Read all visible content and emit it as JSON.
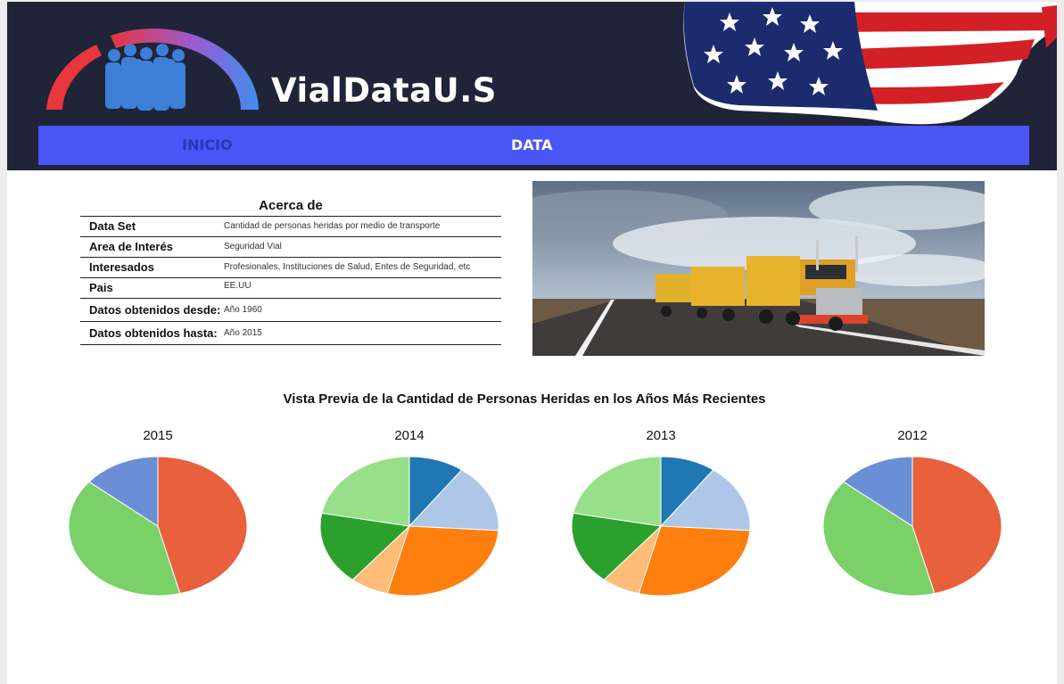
{
  "header": {
    "brand": "VialDataU.S",
    "logo_icon": "people-gauge-logo",
    "flag_icon": "usa-flag-map"
  },
  "nav": {
    "items": [
      {
        "label": "INICIO"
      },
      {
        "label": "DATA"
      }
    ]
  },
  "about": {
    "title": "Acerca de",
    "rows": [
      {
        "key": "Data Set",
        "value": "Cantidad de personas heridas por medio de transporte"
      },
      {
        "key": "Area de Interés",
        "value": "Seguridad Vial"
      },
      {
        "key": "Interesados",
        "value": "Profesionales, Instituciones de Salud, Entes de Seguridad, etc"
      },
      {
        "key": "Pais",
        "value": "EE.UU"
      },
      {
        "key": "Datos obtenidos desde:",
        "value": "Año 1960"
      },
      {
        "key": "Datos obtenidos hasta:",
        "value": "Año 2015"
      }
    ]
  },
  "photo": {
    "subject": "road-train-truck-on-highway"
  },
  "preview": {
    "title": "Vista Previa de la Cantidad de Personas Heridas en los Años Más Recientes"
  },
  "chart_data": [
    {
      "type": "pie",
      "title": "2015",
      "values": [
        46,
        40,
        14
      ],
      "colors": [
        "#e8603c",
        "#79d168",
        "#6a8fd6"
      ]
    },
    {
      "type": "pie",
      "title": "2014",
      "values": [
        10,
        16,
        28,
        7,
        17,
        22
      ],
      "colors": [
        "#1f77b4",
        "#aec7e8",
        "#ff7f0e",
        "#ffbb78",
        "#2ca02c",
        "#98df8a"
      ]
    },
    {
      "type": "pie",
      "title": "2013",
      "values": [
        10,
        16,
        28,
        7,
        17,
        22
      ],
      "colors": [
        "#1f77b4",
        "#aec7e8",
        "#ff7f0e",
        "#ffbb78",
        "#2ca02c",
        "#98df8a"
      ]
    },
    {
      "type": "pie",
      "title": "2012",
      "values": [
        46,
        40,
        14
      ],
      "colors": [
        "#e8603c",
        "#79d168",
        "#6a8fd6"
      ]
    }
  ]
}
